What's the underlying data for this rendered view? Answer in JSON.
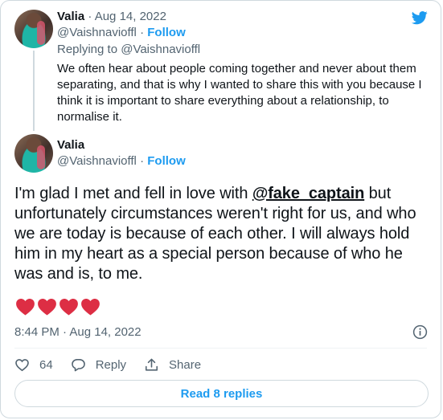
{
  "reply_tweet": {
    "author_name": "Valia",
    "date": "· Aug 14, 2022",
    "handle": "@Vaishnavioffl",
    "separator": "·",
    "follow_label": "Follow",
    "replying_to_prefix": "Replying to ",
    "replying_to_handle": "@Vaishnavioffl",
    "text": "We often hear about people coming together and never about them separating, and that is why I wanted to share this with you because I think it is important to share everything about a relationship, to normalise it."
  },
  "main_tweet": {
    "author_name": "Valia",
    "handle": "@Vaishnavioffl",
    "separator": "·",
    "follow_label": "Follow",
    "text_before": "I'm glad I met and fell in love with ",
    "mention": "@fake_captain",
    "text_after": " but unfortunately circumstances weren't right for us, and who we are today is because of each other. I will always hold him in my heart as a special person because of who he was and is, to me.",
    "timestamp": "8:44 PM · Aug 14, 2022",
    "likes_count": "64",
    "reply_label": "Reply",
    "share_label": "Share",
    "read_replies_label": "Read 8 replies"
  },
  "icons": {
    "brand": "twitter-bird-icon",
    "info": "info-icon",
    "like": "heart-outline-icon",
    "reply": "speech-bubble-icon",
    "share": "share-upload-icon",
    "emoji": "red-heart-emoji"
  },
  "colors": {
    "accent": "#1d9bf0",
    "text": "#0f1419",
    "muted": "#536471",
    "heart_emoji": "#dd2e44",
    "border": "#cfd9de"
  }
}
